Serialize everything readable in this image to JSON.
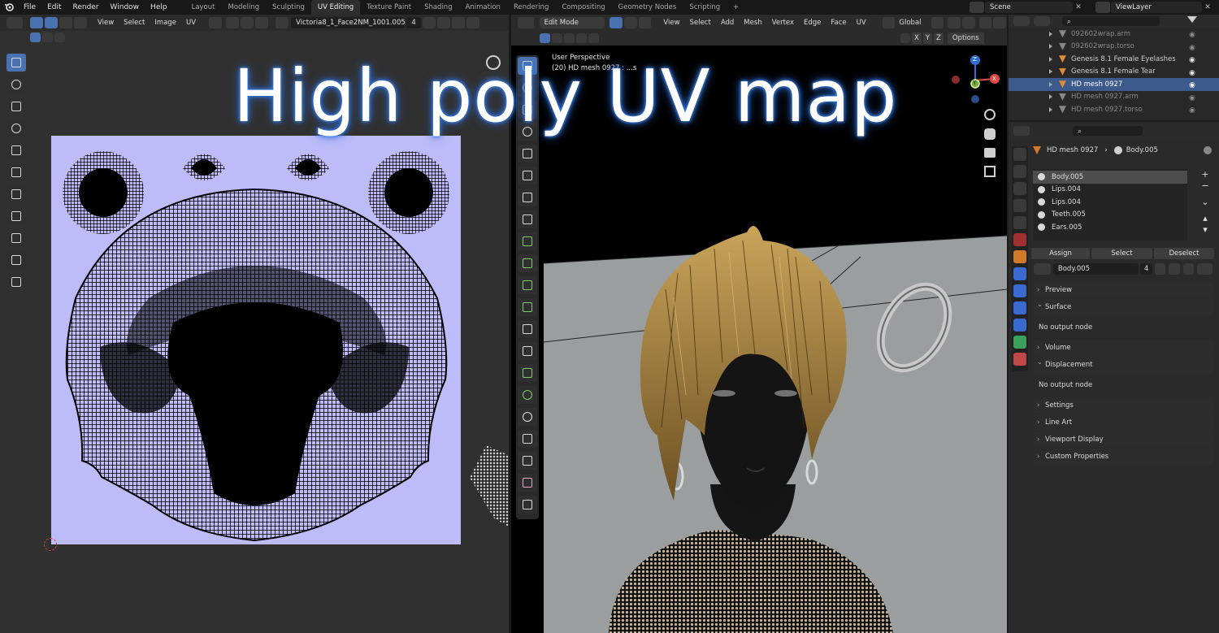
{
  "top_menu": [
    "File",
    "Edit",
    "Render",
    "Window",
    "Help"
  ],
  "workspace_tabs": [
    {
      "label": "Layout",
      "active": false
    },
    {
      "label": "Modeling",
      "active": false
    },
    {
      "label": "Sculpting",
      "active": false
    },
    {
      "label": "UV Editing",
      "active": true
    },
    {
      "label": "Texture Paint",
      "active": false
    },
    {
      "label": "Shading",
      "active": false
    },
    {
      "label": "Animation",
      "active": false
    },
    {
      "label": "Rendering",
      "active": false
    },
    {
      "label": "Compositing",
      "active": false
    },
    {
      "label": "Geometry Nodes",
      "active": false
    },
    {
      "label": "Scripting",
      "active": false
    }
  ],
  "add_workspace_symbol": "+",
  "scene": {
    "label": "Scene",
    "view_layer": "ViewLayer"
  },
  "uv_editor": {
    "menus": [
      "View",
      "Select",
      "Image",
      "UV"
    ],
    "image_name": "Victoria8_1_Face2NM_1001.005",
    "user_count": "4",
    "colors": {
      "uv_background": "#bdbbf8",
      "mesh_lines": "#000000"
    }
  },
  "viewport": {
    "mode": "Edit Mode",
    "menus": [
      "View",
      "Select",
      "Add",
      "Mesh",
      "Vertex",
      "Edge",
      "Face",
      "UV"
    ],
    "transform_orientation": "Global",
    "axes": [
      "X",
      "Y",
      "Z"
    ],
    "options_label": "Options",
    "overlay_line1": "User Perspective",
    "overlay_line2": "(20) HD  mesh 0927 : ...s",
    "gizmo_labels": {
      "x": "X",
      "y": "Y",
      "z": "Z"
    }
  },
  "outliner": {
    "items": [
      {
        "label": "092602wrap.arm",
        "selected": false
      },
      {
        "label": "092602wrap.torso",
        "selected": false
      },
      {
        "label": "Genesis 8.1 Female Eyelashes",
        "selected": false
      },
      {
        "label": "Genesis 8.1 Female Tear",
        "selected": false
      },
      {
        "label": "HD  mesh 0927",
        "selected": true
      },
      {
        "label": "HD  mesh 0927.arm",
        "selected": false
      },
      {
        "label": "HD  mesh 0927.torso",
        "selected": false
      }
    ]
  },
  "properties": {
    "breadcrumb_object": "HD  mesh 0927",
    "breadcrumb_material": "Body.005",
    "material_slots": [
      {
        "label": "Body.005",
        "selected": true
      },
      {
        "label": "Lips.004",
        "selected": false
      },
      {
        "label": "Lips.004",
        "selected": false
      },
      {
        "label": "Teeth.005",
        "selected": false
      },
      {
        "label": "Ears.005",
        "selected": false
      }
    ],
    "assign_label": "Assign",
    "select_label": "Select",
    "deselect_label": "Deselect",
    "material_name": "Body.005",
    "material_users": "4",
    "panels": {
      "preview": "Preview",
      "surface": "Surface",
      "surface_body": "No output node",
      "volume": "Volume",
      "displacement": "Displacement",
      "displacement_body": "No output node",
      "settings": "Settings",
      "line_art": "Line Art",
      "viewport_display": "Viewport Display",
      "custom_properties": "Custom Properties"
    }
  },
  "title_overlay": "High poly UV map",
  "colors": {
    "accent": "#4a72b0",
    "selected_row": "#3d5a8c",
    "hair": "#9a7436",
    "skin": "#1a1a1a"
  }
}
